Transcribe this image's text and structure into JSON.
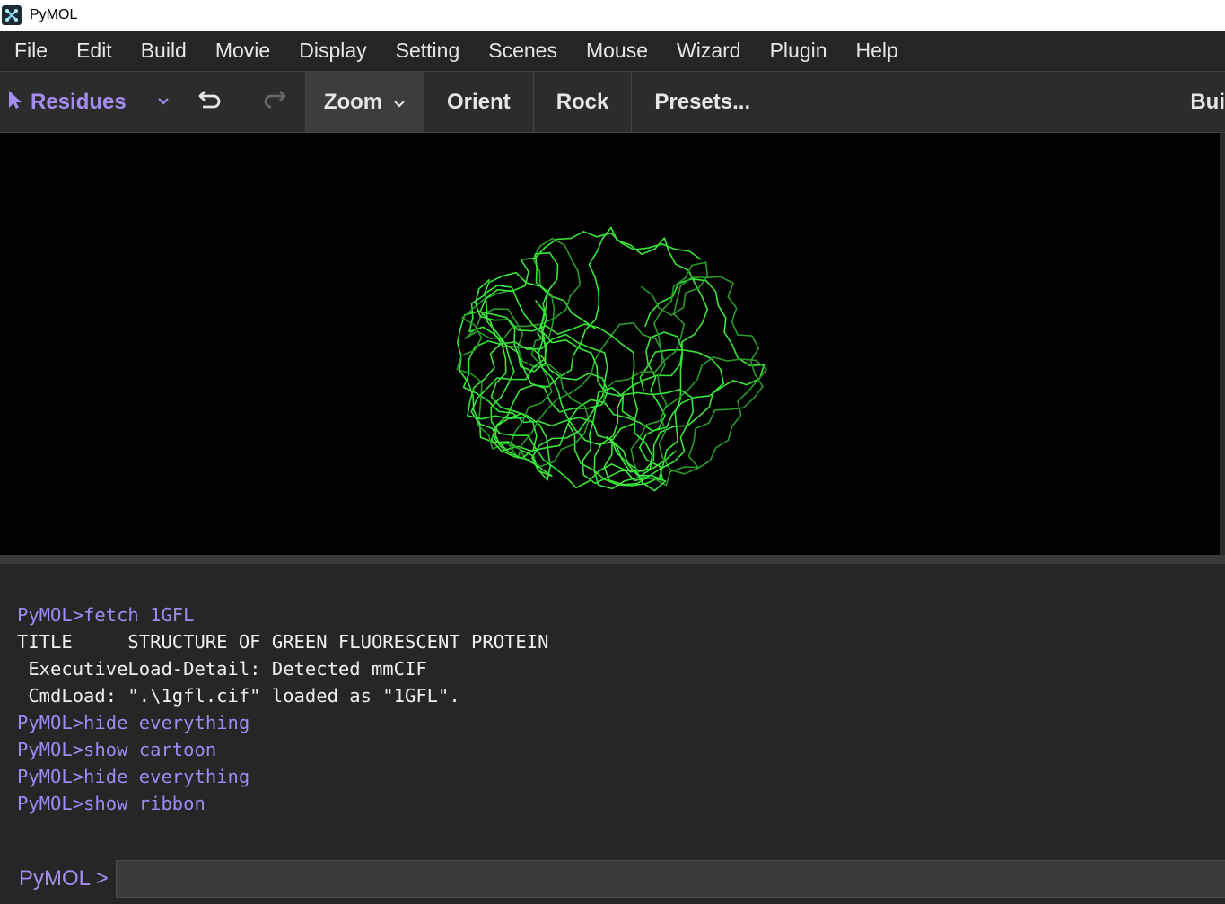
{
  "window": {
    "title": "PyMOL"
  },
  "menubar": {
    "items": [
      "File",
      "Edit",
      "Build",
      "Movie",
      "Display",
      "Setting",
      "Scenes",
      "Mouse",
      "Wizard",
      "Plugin",
      "Help"
    ]
  },
  "toolbar": {
    "selection_mode": "Residues",
    "zoom": "Zoom",
    "orient": "Orient",
    "rock": "Rock",
    "presets": "Presets...",
    "build_partial": "Bui"
  },
  "viewport": {
    "representation": "ribbon",
    "color": "#3ae63a"
  },
  "console": {
    "lines": [
      {
        "type": "cmd",
        "text": "PyMOL>fetch 1GFL"
      },
      {
        "type": "out",
        "text": "TITLE     STRUCTURE OF GREEN FLUORESCENT PROTEIN"
      },
      {
        "type": "out",
        "text": " ExecutiveLoad-Detail: Detected mmCIF"
      },
      {
        "type": "out",
        "text": " CmdLoad: \".\\1gfl.cif\" loaded as \"1GFL\"."
      },
      {
        "type": "cmd",
        "text": "PyMOL>hide everything"
      },
      {
        "type": "cmd",
        "text": "PyMOL>show cartoon"
      },
      {
        "type": "cmd",
        "text": "PyMOL>hide everything"
      },
      {
        "type": "cmd",
        "text": "PyMOL>show ribbon"
      }
    ]
  },
  "command": {
    "prompt": "PyMOL >",
    "value": ""
  },
  "colors": {
    "accent": "#a48cf0",
    "command_text": "#9b8cf5",
    "ribbon": "#3ae63a"
  }
}
